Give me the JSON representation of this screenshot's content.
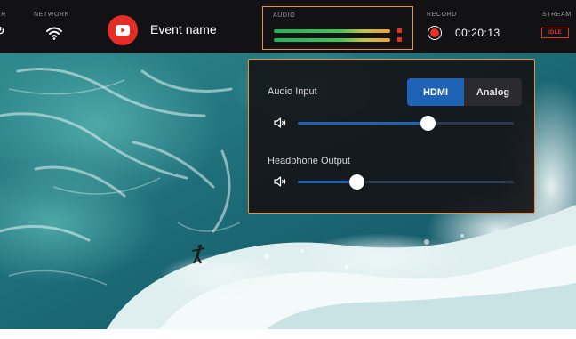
{
  "topbar": {
    "power_label": "ER",
    "network_label": "NETWORK",
    "event_name": "Event name",
    "audio_label": "AUDIO",
    "record_label": "RECORD",
    "record_time": "00:20:13",
    "stream_label": "STREAM",
    "stream_badge": "IDLE"
  },
  "audio_meters": {
    "left_level": 0.9,
    "right_level": 0.9
  },
  "audio_popup": {
    "audio_input_label": "Audio Input",
    "input_options": [
      "HDMI",
      "Analog"
    ],
    "selected_input": "HDMI",
    "audio_input_level": 0.6,
    "headphone_output_label": "Headphone Output",
    "headphone_output_level": 0.27
  },
  "colors": {
    "accent_orange": "#f0922b",
    "selected_blue": "#1e63b5",
    "record_red": "#e53224",
    "youtube_red": "#e52d27"
  },
  "icons": [
    "power-icon",
    "wifi-icon",
    "youtube-play-icon",
    "record-icon",
    "speaker-icon"
  ]
}
